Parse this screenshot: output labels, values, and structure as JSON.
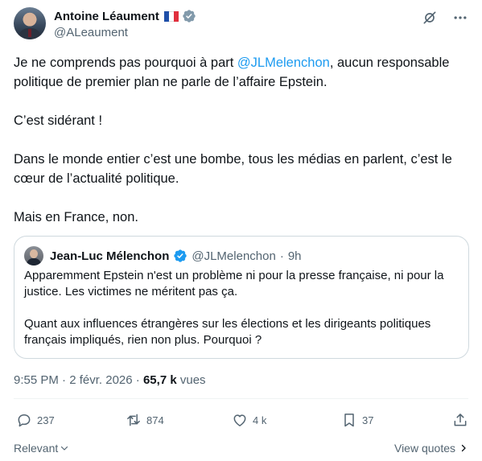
{
  "author": {
    "display_name": "Antoine Léaument",
    "handle": "@ALeaument",
    "flag_icon": "france-flag-icon",
    "verified_icon": "verified-badge-icon"
  },
  "header_actions": {
    "grok_icon": "grok-icon",
    "more_icon": "more-icon"
  },
  "tweet": {
    "line1_before": "Je ne comprends pas pourquoi à part ",
    "line1_mention": "@JLMelenchon",
    "line1_after": ", aucun responsable politique de premier plan ne parle de l’affaire Epstein.",
    "para2": "C’est sidérant !",
    "para3": "Dans le monde entier c’est une bombe, tous les médias en parlent, c’est le cœur de l’actualité politique.",
    "para4": "Mais en France, non."
  },
  "quote": {
    "display_name": "Jean-Luc Mélenchon",
    "handle": "@JLMelenchon",
    "separator": "·",
    "time": "9h",
    "para1": "Apparemment Epstein n'est un problème ni pour la presse française, ni pour la justice. Les victimes ne méritent pas ça.",
    "para2": "Quant aux influences étrangères sur les élections et les dirigeants politiques français impliqués, rien non plus. Pourquoi ?"
  },
  "meta": {
    "time": "9:55 PM",
    "separator": "·",
    "date": "2 févr. 2026",
    "views_count": "65,7 k",
    "views_label": "vues"
  },
  "actions": {
    "replies": "237",
    "reposts": "874",
    "likes": "4 k",
    "bookmarks": "37"
  },
  "footer": {
    "sort_label": "Relevant",
    "view_quotes_label": "View quotes"
  },
  "colors": {
    "accent": "#1d9bf0",
    "secondary_text": "#536471",
    "primary_text": "#0f1419",
    "border": "#cfd9de"
  }
}
